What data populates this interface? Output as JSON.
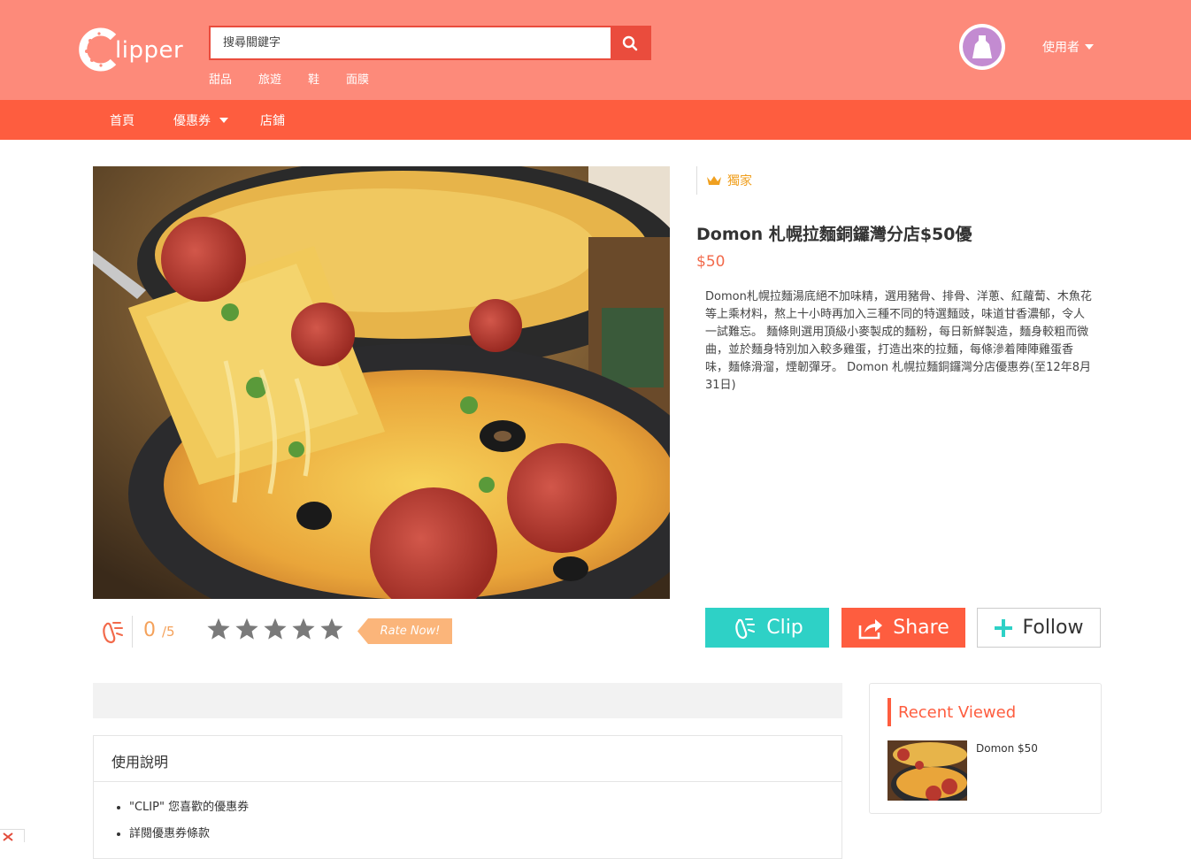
{
  "colors": {
    "header": "#fd8a7a",
    "navbar": "#fe5d3f",
    "accent_red": "#ea4c3d",
    "clip_teal": "#2ed1c6",
    "price": "#f26a4b",
    "badge": "#f0a020",
    "rating": "#f4a15a"
  },
  "header": {
    "logo_text": "lipper",
    "search_placeholder": "搜尋關鍵字",
    "tags": [
      "甜品",
      "旅遊",
      "鞋",
      "面膜"
    ],
    "user_label": "使用者"
  },
  "nav": {
    "home": "首頁",
    "coupons": "優惠券",
    "stores": "店鋪"
  },
  "product": {
    "badge": "獨家",
    "title": "Domon 札幌拉麵銅鑼灣分店$50優",
    "price": "$50",
    "description": "Domon札幌拉麵湯底絕不加味精，選用豬骨、排骨、洋蔥、紅蘿蔔、木魚花等上乘材料，熬上十小時再加入三種不同的特選麵豉，味道甘香濃郁，令人一試難忘。 麵條則選用頂級小麥製成的麵粉，每日新鮮製造，麵身較粗而微曲，並於麵身特別加入較多雞蛋，打造出來的拉麵，每條滲着陣陣雞蛋香味，麵條滑溜，煙韌彈牙。 Domon 札幌拉麵銅鑼灣分店優惠券(至12年8月31日)"
  },
  "rating": {
    "score": "0",
    "out_of": "/5",
    "stars_filled": 0,
    "stars_total": 5,
    "rate_now": "Rate Now!"
  },
  "actions": {
    "clip": "Clip",
    "share": "Share",
    "follow": "Follow"
  },
  "usage": {
    "title": "使用說明",
    "items": [
      "\"CLIP\" 您喜歡的優惠券",
      "詳閱優惠券條款"
    ]
  },
  "recent": {
    "title": "Recent Viewed",
    "items": [
      {
        "label": "Domon $50"
      }
    ]
  }
}
